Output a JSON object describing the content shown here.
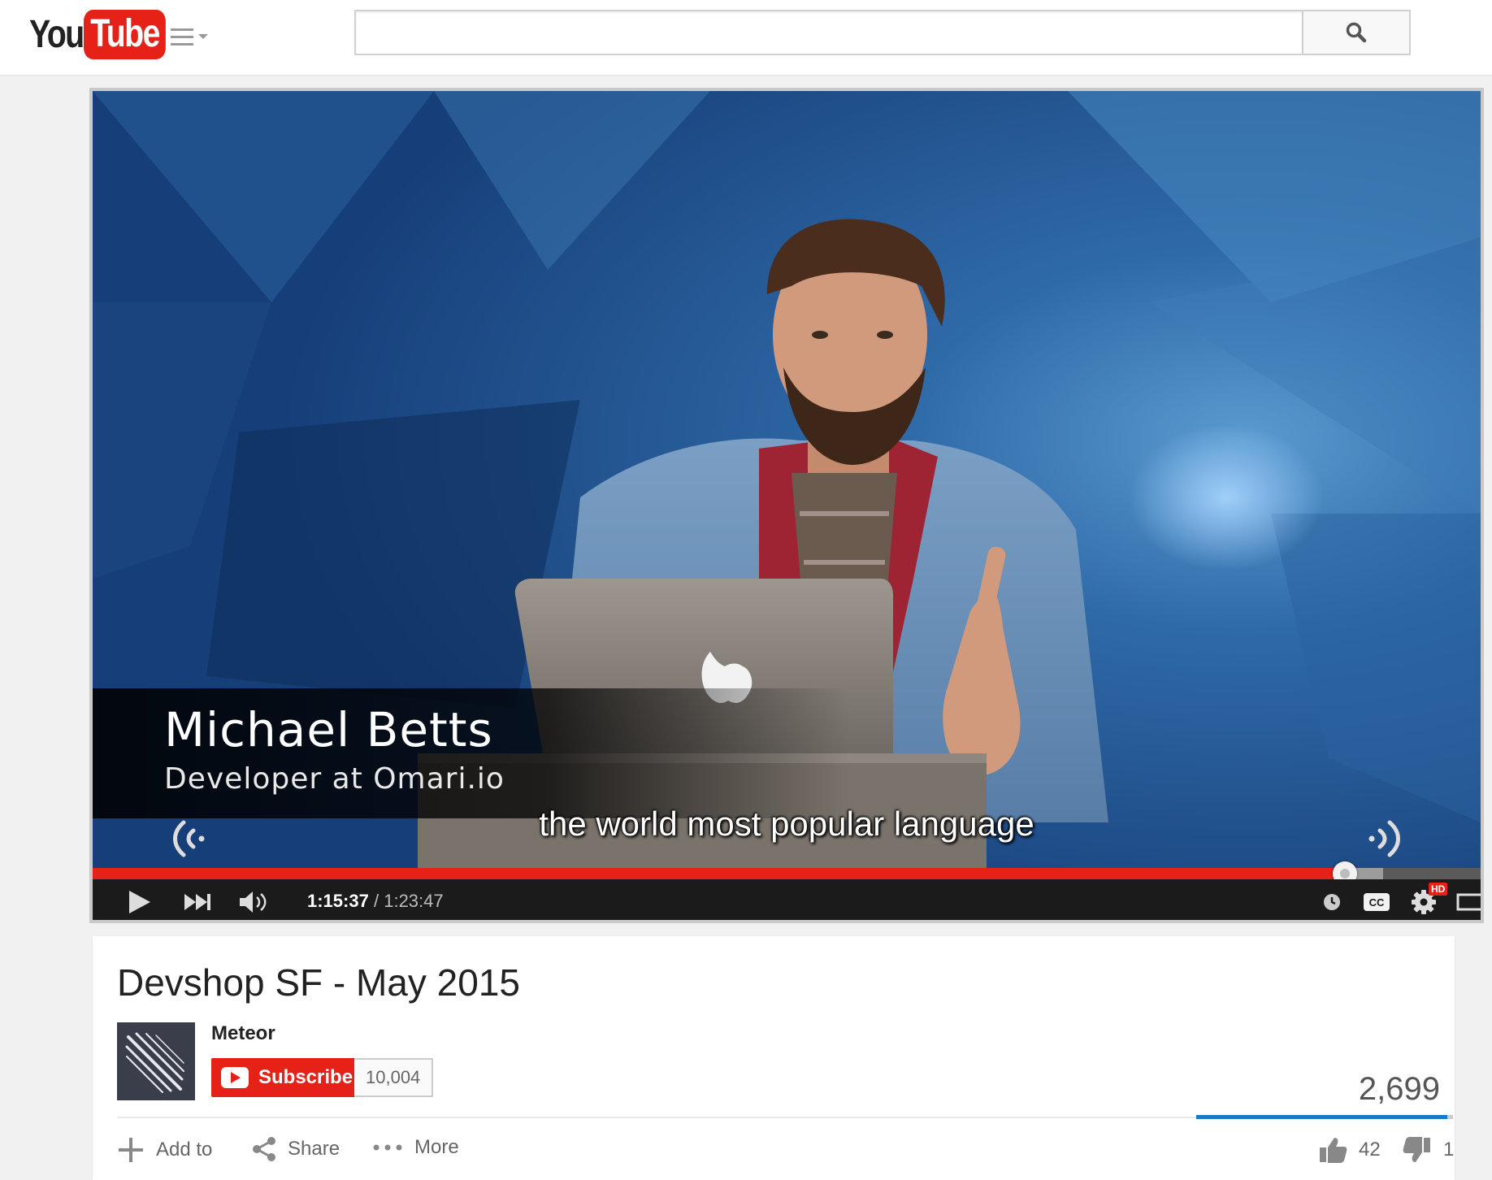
{
  "header": {
    "logo_you": "You",
    "logo_tube": "Tube",
    "search_placeholder": "",
    "search_value": ""
  },
  "player": {
    "speaker_name": "Michael Betts",
    "speaker_title": "Developer at Omari.io",
    "caption": "the world most popular language",
    "current_time": "1:15:37",
    "time_separator": "/",
    "duration": "1:23:47",
    "played_fraction": 0.9025,
    "buffered_fraction": 0.93,
    "hd_badge": "HD",
    "cc_label": "CC",
    "icons": [
      "play-icon",
      "next-icon",
      "volume-icon",
      "watch-later-icon",
      "cc-icon",
      "settings-icon",
      "theater-mode-icon",
      "fullscreen-icon"
    ]
  },
  "video": {
    "title": "Devshop SF - May 2015",
    "channel": "Meteor",
    "subscribe_label": "Subscribe",
    "subscriber_count": "10,004",
    "view_count": "2,699",
    "like_fraction": 0.977
  },
  "actions": {
    "add_to": "Add to",
    "share": "Share",
    "more": "More",
    "likes": "42",
    "dislikes": "1"
  },
  "colors": {
    "brand_red": "#e62117",
    "like_blue": "#167ac6"
  }
}
